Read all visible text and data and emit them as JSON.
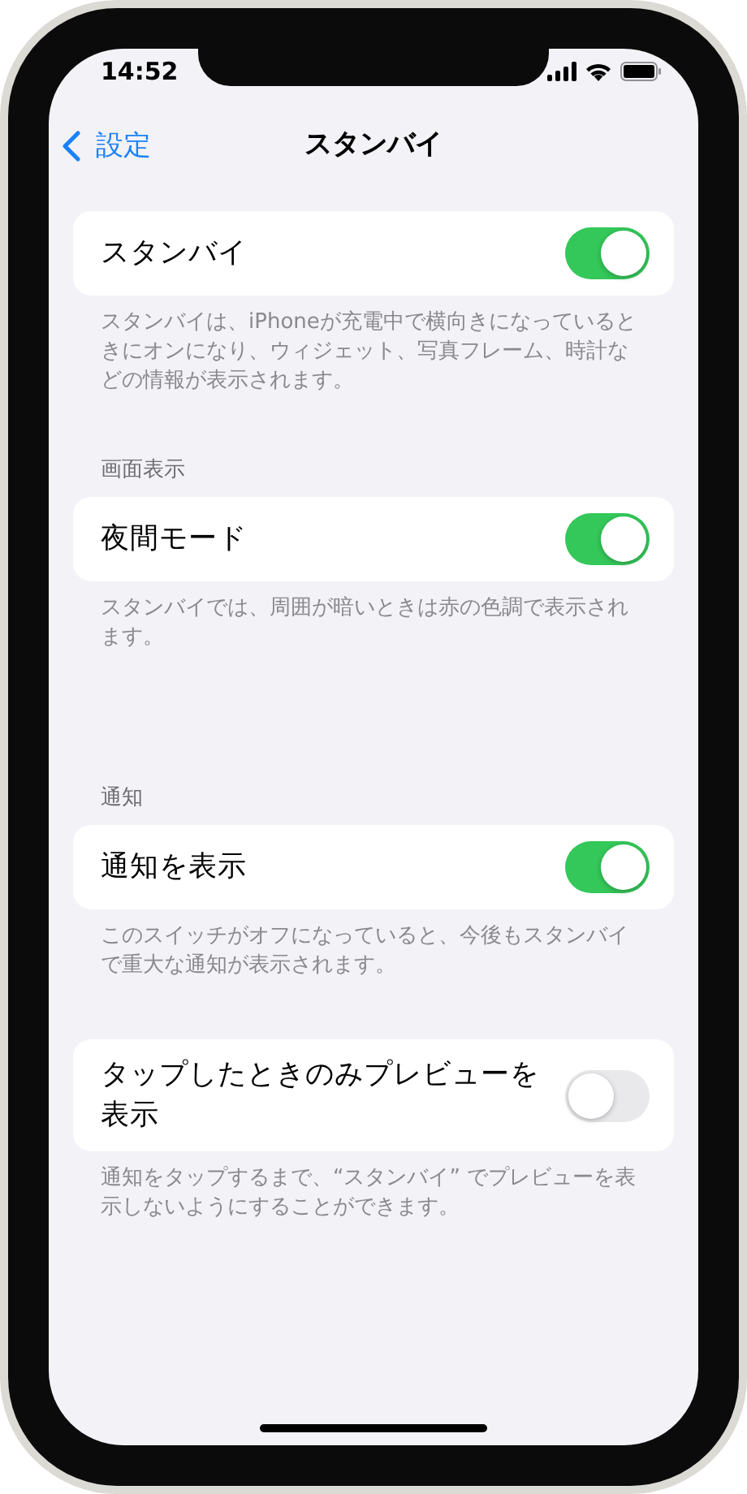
{
  "status_bar": {
    "time": "14:52"
  },
  "nav": {
    "back": "設定",
    "title": "スタンバイ"
  },
  "groups": [
    {
      "rows": [
        {
          "label": "スタンバイ",
          "on": true
        }
      ],
      "footer": "スタンバイは、iPhoneが充電中で横向きになっているときにオンになり、ウィジェット、写真フレーム、時計などの情報が表示されます。"
    },
    {
      "header": "画面表示",
      "rows": [
        {
          "label": "夜間モード",
          "on": true
        }
      ],
      "footer": "スタンバイでは、周囲が暗いときは赤の色調で表示されます。"
    },
    {
      "header": "通知",
      "rows": [
        {
          "label": "通知を表示",
          "on": true
        }
      ],
      "footer": "このスイッチがオフになっていると、今後もスタンバイで重大な通知が表示されます。"
    },
    {
      "rows": [
        {
          "label": "タップしたときのみプレビューを表示",
          "on": false
        }
      ],
      "footer": "通知をタップするまで、“スタンバイ” でプレビューを表示しないようにすることができます。"
    }
  ]
}
